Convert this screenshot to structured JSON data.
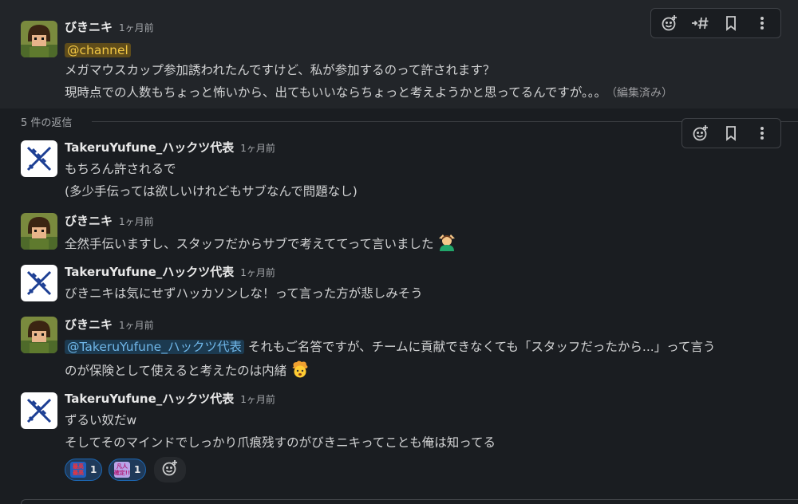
{
  "parent": {
    "author": "びきニキ",
    "time": "1ヶ月前",
    "channel_mention": "@channel",
    "line1": "メガマウスカップ参加誘われたんですけど、私が参加するのって許されます？",
    "line2": "現時点での人数もちょっと怖いから、出てもいいならちょっと考えようかと思ってるんですが。。。",
    "edited": "（編集済み）"
  },
  "thread": {
    "reply_count_label": "5 件の返信"
  },
  "replies": [
    {
      "author": "TakeruYufune_ハックツ代表",
      "time": "1ヶ月前",
      "line1": "もちろん許されるで",
      "line2": "(多少手伝っては欲しいけれどもサブなんで問題なし)"
    },
    {
      "author": "びきニキ",
      "time": "1ヶ月前",
      "line1": "全然手伝いますし、スタッフだからサブで考えててって言いました",
      "emoji": "person-gesturing-ok"
    },
    {
      "author": "TakeruYufune_ハックツ代表",
      "time": "1ヶ月前",
      "line1": "びきニキは気にせずハッカソンしな！って言った方が悲しみそう"
    },
    {
      "author": "びきニキ",
      "time": "1ヶ月前",
      "user_mention": "@TakeruYufune_ハックツ代表",
      "line1": "それもご名答ですが、チームに貢献できなくても「スタッフだったから...」って言う",
      "line2": "のが保険として使えると考えたのは内緒",
      "emoji": "exploding-head"
    },
    {
      "author": "TakeruYufune_ハックツ代表",
      "time": "1ヶ月前",
      "line1": "ずるい奴だw",
      "line2": "そしてそのマインドでしっかり爪痕残すのがびきニキってことも俺は知ってる"
    }
  ],
  "reactions": [
    {
      "emoji_text": "最高\n最高",
      "count": "1",
      "bg": "#1f5fbf",
      "fg": "#ff3030"
    },
    {
      "emoji_text": "凡人\n確定!!",
      "count": "1",
      "bg": "#b9a4e8",
      "fg": "#b0207a"
    }
  ],
  "toolbar_icons": [
    "add-reaction-icon",
    "reply-in-channel-icon",
    "bookmark-icon",
    "more-actions-icon"
  ],
  "colors": {
    "background": "#1a1d21",
    "highlight": "#222529",
    "channel_mention": "#f2c744",
    "user_mention": "#6fb6e8"
  }
}
